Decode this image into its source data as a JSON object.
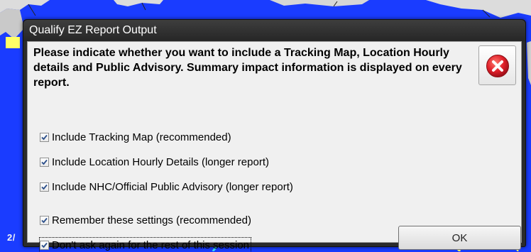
{
  "background": {
    "caption": "2/",
    "colors": {
      "ocean": "#1a3cff",
      "land": "#d9d9d9",
      "track_circle": "#ffff66",
      "track_circle_alt": "#33ddff"
    }
  },
  "dialog": {
    "title": "Qualify EZ Report Output",
    "message": "Please indicate whether you want to include a Tracking Map, Location Hourly details and Public Advisory.  Summary impact information is displayed on every report.",
    "close_icon": "close-circle-icon",
    "options": [
      {
        "label": "Include Tracking Map (recommended)",
        "checked": true
      },
      {
        "label": "Include Location Hourly Details (longer report)",
        "checked": true
      },
      {
        "label": "Include NHC/Official Public Advisory (longer report)",
        "checked": true
      },
      {
        "label": "Remember these settings (recommended)",
        "checked": true
      },
      {
        "label": "Don't ask again for the rest of this session",
        "checked": true
      }
    ],
    "ok_label": "OK",
    "colors": {
      "title_bar": "#2b2b2b",
      "client": "#f0f0f0",
      "close_icon": "#e0202a"
    }
  }
}
